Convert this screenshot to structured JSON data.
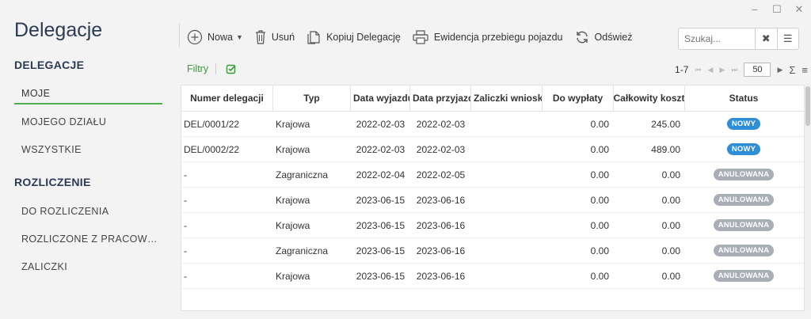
{
  "window": {
    "minimize": "–",
    "maximize": "☐",
    "close": "✕"
  },
  "app": {
    "title": "Delegacje"
  },
  "sidebar": {
    "sections": [
      {
        "label": "DELEGACJE",
        "items": [
          {
            "label": "MOJE",
            "active": true
          },
          {
            "label": "MOJEGO DZIAŁU"
          },
          {
            "label": "WSZYSTKIE"
          }
        ]
      },
      {
        "label": "ROZLICZENIE",
        "items": [
          {
            "label": "DO ROZLICZENIA"
          },
          {
            "label": "ROZLICZONE Z PRACOWNI..."
          },
          {
            "label": "ZALICZKI"
          }
        ]
      }
    ]
  },
  "toolbar": {
    "new_label": "Nowa",
    "delete_label": "Usuń",
    "copy_label": "Kopiuj Delegację",
    "mileage_label": "Ewidencja przebiegu pojazdu",
    "refresh_label": "Odśwież"
  },
  "search": {
    "placeholder": "Szukaj..."
  },
  "filters": {
    "label": "Filtry"
  },
  "pager": {
    "range": "1-7",
    "page_size": "50",
    "sum_symbol": "Σ",
    "menu_symbol": "≡"
  },
  "colors": {
    "accent": "#4caf50",
    "badge_new": "#2f8fd6",
    "badge_cancelled": "#a9adb5"
  },
  "table": {
    "columns": [
      "Numer delegacji",
      "Typ",
      "Data wyjazdu",
      "Data przyjazdu",
      "Zaliczki wnioskowane",
      "Do wypłaty",
      "Całkowity koszt",
      "Status"
    ],
    "rows": [
      {
        "num": "DEL/0001/22",
        "typ": "Krajowa",
        "dw": "2022-02-03",
        "dp": "2022-02-03",
        "zal": "",
        "dow": "0.00",
        "cal": "245.00",
        "status": "NOWY",
        "kind": "new"
      },
      {
        "num": "DEL/0002/22",
        "typ": "Krajowa",
        "dw": "2022-02-03",
        "dp": "2022-02-03",
        "zal": "",
        "dow": "0.00",
        "cal": "489.00",
        "status": "NOWY",
        "kind": "new"
      },
      {
        "num": "-",
        "typ": "Zagraniczna",
        "dw": "2022-02-04",
        "dp": "2022-02-05",
        "zal": "",
        "dow": "0.00",
        "cal": "0.00",
        "status": "ANULOWANA",
        "kind": "cancelled"
      },
      {
        "num": "-",
        "typ": "Krajowa",
        "dw": "2023-06-15",
        "dp": "2023-06-16",
        "zal": "",
        "dow": "0.00",
        "cal": "0.00",
        "status": "ANULOWANA",
        "kind": "cancelled"
      },
      {
        "num": "-",
        "typ": "Krajowa",
        "dw": "2023-06-15",
        "dp": "2023-06-16",
        "zal": "",
        "dow": "0.00",
        "cal": "0.00",
        "status": "ANULOWANA",
        "kind": "cancelled"
      },
      {
        "num": "-",
        "typ": "Zagraniczna",
        "dw": "2023-06-15",
        "dp": "2023-06-16",
        "zal": "",
        "dow": "0.00",
        "cal": "0.00",
        "status": "ANULOWANA",
        "kind": "cancelled"
      },
      {
        "num": "-",
        "typ": "Krajowa",
        "dw": "2023-06-15",
        "dp": "2023-06-16",
        "zal": "",
        "dow": "0.00",
        "cal": "0.00",
        "status": "ANULOWANA",
        "kind": "cancelled"
      }
    ]
  }
}
